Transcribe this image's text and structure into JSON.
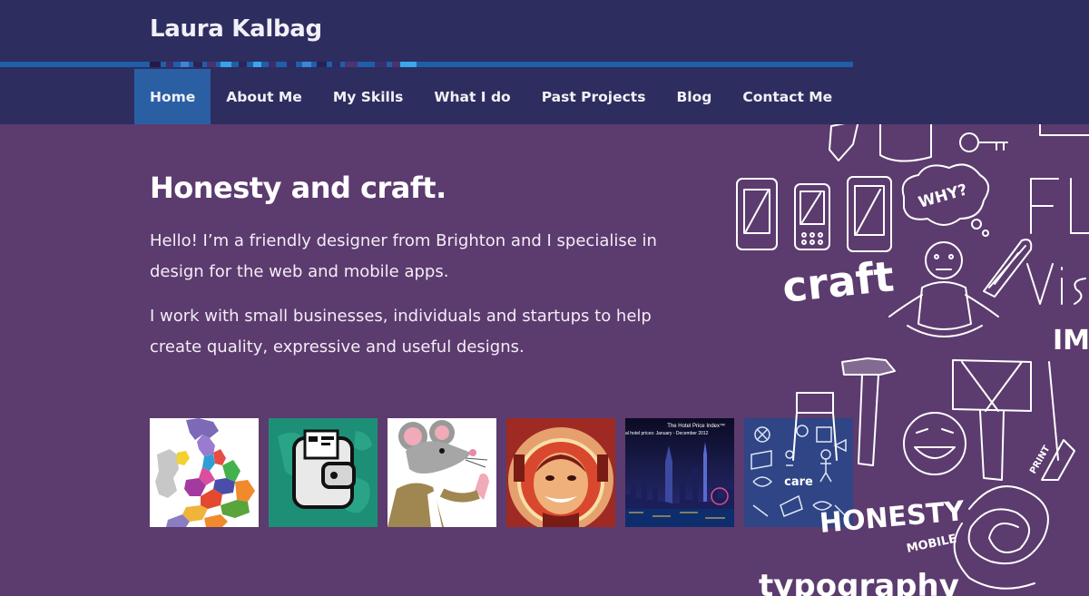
{
  "site": {
    "title": "Laura Kalbag"
  },
  "nav": {
    "items": [
      {
        "label": "Home",
        "active": true
      },
      {
        "label": "About Me"
      },
      {
        "label": "My Skills"
      },
      {
        "label": "What I do"
      },
      {
        "label": "Past Projects"
      },
      {
        "label": "Blog"
      },
      {
        "label": "Contact Me"
      }
    ]
  },
  "hero": {
    "title": "Honesty and craft.",
    "paragraph1": "Hello! I’m a friendly designer from Brighton and I specialise in design for the web and mobile apps.",
    "paragraph2": "I work with small businesses, individuals and startups to help create quality, expressive and useful designs."
  },
  "thumbnails": {
    "hotel_caption1": "The Hotel Price Index™",
    "hotel_caption2": "al hotel prices: January - December 2012",
    "care_label": "care"
  },
  "doodles": {
    "craft": "craft",
    "why": "WHY?",
    "honesty": "HONESTY",
    "mobile": "MOBILE",
    "typography": "typography",
    "vis": "Vis",
    "im": "IM",
    "fl": "FL",
    "print": "PRINT"
  },
  "colors": {
    "background": "#5c3b6e",
    "header": "#2e2d60",
    "active_nav": "#2a5fa4",
    "stripe": "#1f5ea8"
  }
}
